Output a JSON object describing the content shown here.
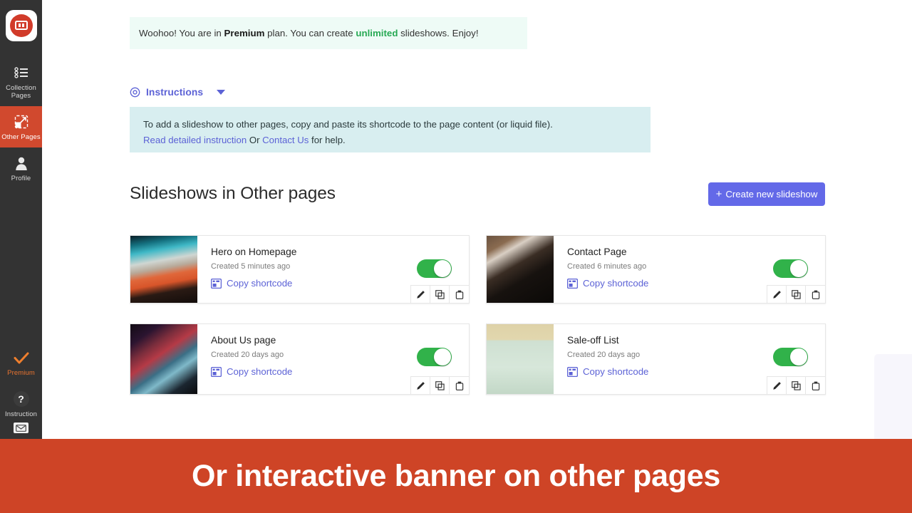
{
  "sidebar": {
    "logo_icon": "app-logo-icon",
    "items": [
      {
        "id": "collection-pages",
        "label": "Collection\nPages",
        "label_line1": "Collection",
        "label_line2": "Pages",
        "icon": "list-icon",
        "active": false
      },
      {
        "id": "other-pages",
        "label": "Other Pages",
        "icon": "external-frame-icon",
        "active": true
      },
      {
        "id": "profile",
        "label": "Profile",
        "icon": "user-icon",
        "active": false
      }
    ],
    "bottom_items": [
      {
        "id": "premium",
        "label": "Premium",
        "icon": "check-icon"
      },
      {
        "id": "instruction",
        "label": "Instruction",
        "icon": "question-mark-icon"
      },
      {
        "id": "mail",
        "label": "",
        "icon": "envelope-icon"
      }
    ]
  },
  "premium_banner": {
    "prefix": "Woohoo! You are in ",
    "plan": "Premium",
    "middle": " plan. You can create ",
    "highlight": "unlimited",
    "suffix": " slideshows. Enjoy!",
    "highlight_color": "#27a954",
    "background": "#eefbf6"
  },
  "instructions": {
    "title": "Instructions",
    "icon": "gear-icon",
    "caret_icon": "chevron-down-icon",
    "expanded": true,
    "body_line1": "To add a slideshow to other pages, copy and paste its shortcode to the page content (or liquid file).",
    "link_read": "Read detailed instruction",
    "between": " Or ",
    "link_contact": "Contact Us",
    "tail": " for help.",
    "background": "#d8eef0",
    "link_color": "#5c62d6"
  },
  "section": {
    "title": "Slideshows in Other pages",
    "create_button": {
      "label": "Create new slideshow",
      "icon": "plus-icon",
      "color": "#6369e8"
    }
  },
  "cards": [
    {
      "title": "Hero on Homepage",
      "created": "Created 5 minutes ago",
      "copy_label": "Copy shortcode",
      "copy_icon": "shortcode-icon",
      "enabled": true,
      "thumb": "abstract-teal-orange-fluid",
      "actions": [
        {
          "name": "edit",
          "icon": "pencil-icon"
        },
        {
          "name": "duplicate",
          "icon": "copy-icon"
        },
        {
          "name": "delete",
          "icon": "trash-icon"
        }
      ]
    },
    {
      "title": "Contact Page",
      "created": "Created 6 minutes ago",
      "copy_label": "Copy shortcode",
      "copy_icon": "shortcode-icon",
      "enabled": true,
      "thumb": "hands-wrapping-dark-garment",
      "actions": [
        {
          "name": "edit",
          "icon": "pencil-icon"
        },
        {
          "name": "duplicate",
          "icon": "copy-icon"
        },
        {
          "name": "delete",
          "icon": "trash-icon"
        }
      ]
    },
    {
      "title": "About Us page",
      "created": "Created 20 days ago",
      "copy_label": "Copy shortcode",
      "copy_icon": "shortcode-icon",
      "enabled": true,
      "thumb": "portrait-blue-red-smoke",
      "actions": [
        {
          "name": "edit",
          "icon": "pencil-icon"
        },
        {
          "name": "duplicate",
          "icon": "copy-icon"
        },
        {
          "name": "delete",
          "icon": "trash-icon"
        }
      ]
    },
    {
      "title": "Sale-off List",
      "created": "Created 20 days ago",
      "copy_label": "Copy shortcode",
      "copy_icon": "shortcode-icon",
      "enabled": true,
      "thumb": "pink-backpack-pastel",
      "actions": [
        {
          "name": "edit",
          "icon": "pencil-icon"
        },
        {
          "name": "duplicate",
          "icon": "copy-icon"
        },
        {
          "name": "delete",
          "icon": "trash-icon"
        }
      ]
    }
  ],
  "bottom_banner": {
    "text": "Or interactive banner on other pages",
    "background": "#ce4426",
    "text_color": "#ffffff"
  },
  "colors": {
    "sidebar_bg": "#333333",
    "sidebar_active": "#d1492e",
    "accent_purple": "#5c62d6",
    "toggle_on": "#31b24a",
    "premium_orange": "#e8732f"
  }
}
